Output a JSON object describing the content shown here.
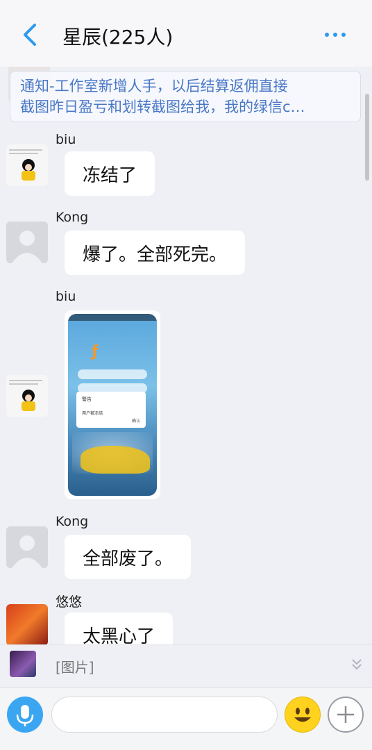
{
  "header": {
    "title": "星辰(225人)"
  },
  "notice": {
    "line1": "通知-工作室新增人手，以后结算返佣直接",
    "line2": "截图昨日盈亏和划转截图给我，我的绿信c…"
  },
  "messages": [
    {
      "sender": "biu",
      "text": "冻结了"
    },
    {
      "sender": "Kong",
      "text": "爆了。全部死完。"
    },
    {
      "sender": "biu",
      "image": {
        "dialog_title": "警告",
        "dialog_text": "用户被冻结",
        "dialog_ok": "确认"
      }
    },
    {
      "sender": "Kong",
      "text": "全部废了。"
    },
    {
      "sender": "悠悠",
      "text": "太黑心了"
    }
  ],
  "preview": {
    "text": "[图片]"
  },
  "icons": {
    "back": "back-chevron-icon",
    "more": "more-dots-icon",
    "mic": "microphone-icon",
    "emoji": "emoji-smile-icon",
    "plus": "plus-icon",
    "collapse": "double-chevron-down-icon"
  },
  "colors": {
    "accent": "#2a9bf0",
    "background": "#eff0f5",
    "notice_text": "#4a78c6"
  }
}
